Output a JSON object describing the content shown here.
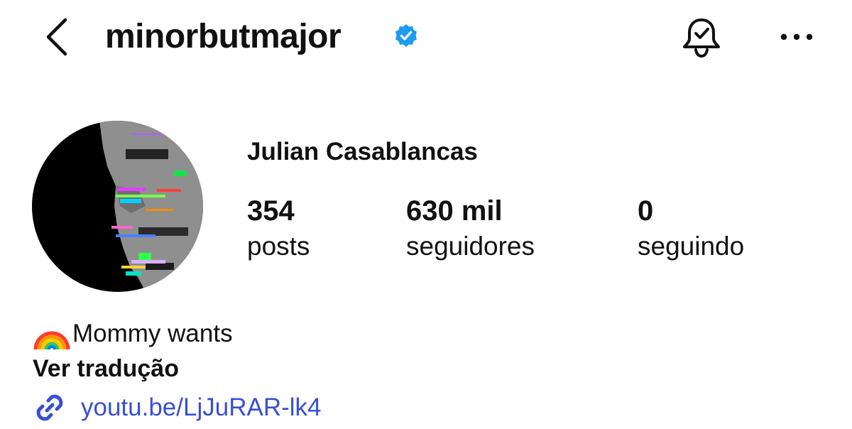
{
  "header": {
    "back_icon": "chevron-left-icon",
    "username": "minorbutmajor",
    "verified_icon": "verified-badge-icon",
    "verified_color": "#1d9bf0",
    "notification_icon": "bell-check-icon",
    "more_icon": "more-horizontal-icon"
  },
  "profile": {
    "display_name": "Julian Casablancas",
    "stats": [
      {
        "value": "354",
        "label": "posts"
      },
      {
        "value": "630 mil",
        "label": "seguidores"
      },
      {
        "value": "0",
        "label": "seguindo"
      }
    ]
  },
  "bio": {
    "emoji": "rainbow",
    "text": "Mommy wants",
    "translate_label": "Ver tradução",
    "link_icon": "link-icon",
    "link_text": "youtu.be/LjJuRAR-lk4",
    "link_color": "#3a4fd0"
  }
}
